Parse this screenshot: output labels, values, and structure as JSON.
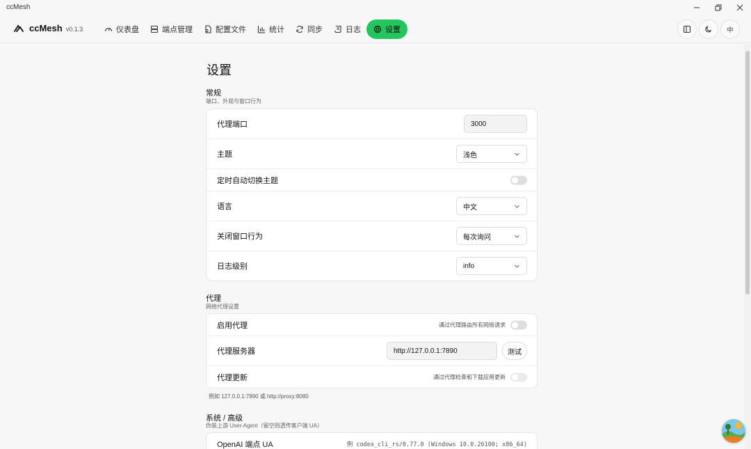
{
  "window": {
    "title": "ccMesh"
  },
  "brand": {
    "name": "ccMesh",
    "version": "v0.1.3"
  },
  "nav": {
    "items": [
      {
        "label": "仪表盘",
        "icon": "gauge-icon"
      },
      {
        "label": "端点管理",
        "icon": "server-icon"
      },
      {
        "label": "配置文件",
        "icon": "file-icon"
      },
      {
        "label": "统计",
        "icon": "bar-chart-icon"
      },
      {
        "label": "同步",
        "icon": "sync-icon"
      },
      {
        "label": "日志",
        "icon": "scroll-icon"
      },
      {
        "label": "设置",
        "icon": "gear-icon",
        "active": true
      }
    ],
    "lang_button": "中"
  },
  "page": {
    "title": "设置"
  },
  "sections": {
    "general": {
      "title": "常规",
      "subtitle": "端口、外观与窗口行为",
      "rows": {
        "port": {
          "label": "代理端口",
          "value": "3000"
        },
        "theme": {
          "label": "主题",
          "value": "浅色"
        },
        "auto_theme": {
          "label": "定时自动切换主题",
          "enabled": false
        },
        "language": {
          "label": "语言",
          "value": "中文"
        },
        "close_behavior": {
          "label": "关闭窗口行为",
          "value": "每次询问"
        },
        "log_level": {
          "label": "日志级别",
          "value": "info"
        }
      }
    },
    "proxy": {
      "title": "代理",
      "subtitle": "网络代理设置",
      "rows": {
        "enable": {
          "label": "启用代理",
          "hint": "通过代理路由所有网络请求",
          "enabled": false
        },
        "server": {
          "label": "代理服务器",
          "value": "http://127.0.0.1:7890",
          "test_label": "测试"
        },
        "update": {
          "label": "代理更新",
          "hint": "通过代理检查和下载应用更新",
          "enabled": false
        }
      },
      "note": "例如 127.0.0.1:7890 或 http://proxy:8080"
    },
    "advanced": {
      "title": "系统 / 高级",
      "subtitle": "伪装上游 User-Agent（留空则透传客户端 UA）",
      "rows": {
        "openai_ua": {
          "label": "OpenAI 端点 UA",
          "placeholder": "例 codex_cli_rs/0.77.0 (Windows 10.0.26100; x86_64)"
        }
      }
    }
  },
  "colors": {
    "accent": "#22c55e"
  }
}
